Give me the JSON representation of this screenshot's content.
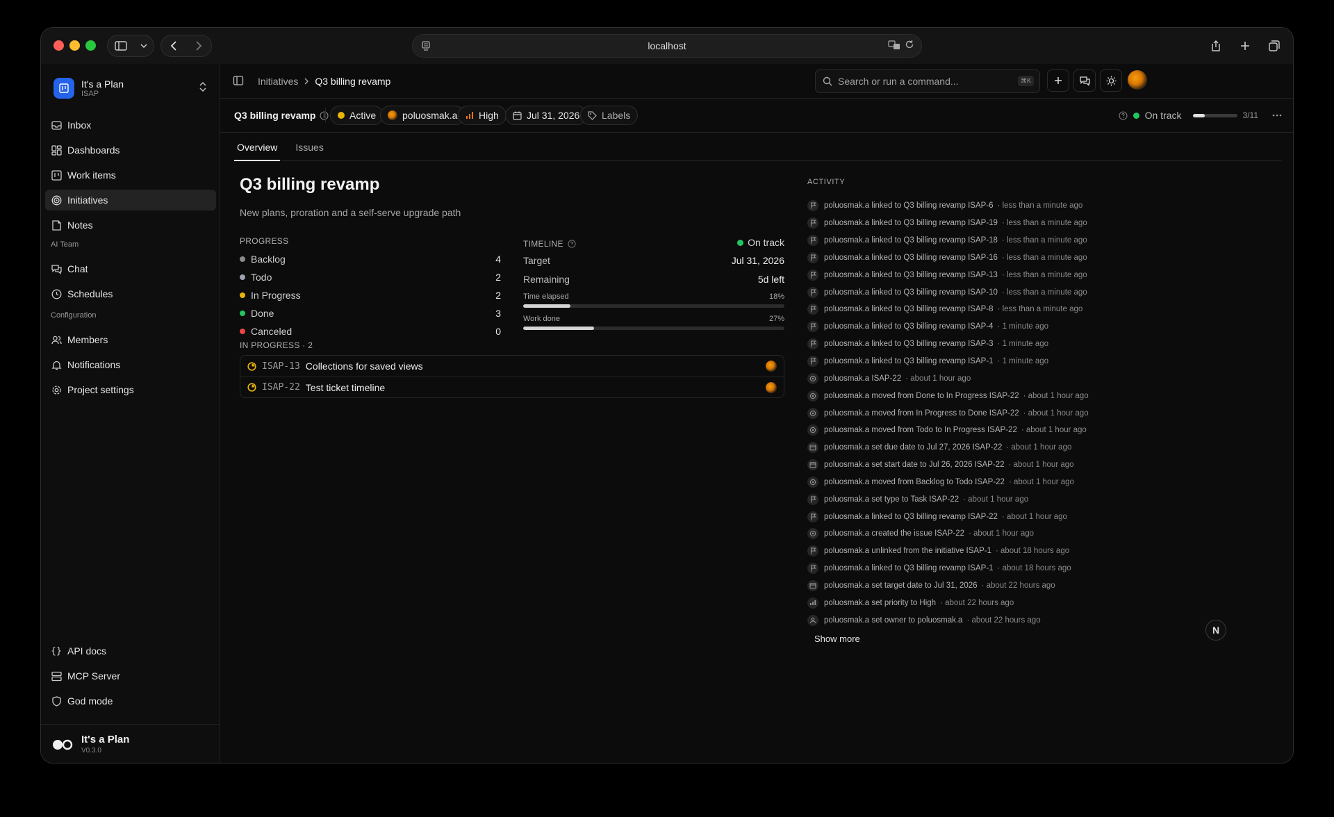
{
  "browser": {
    "url": "localhost"
  },
  "workspace": {
    "name": "It's a Plan",
    "key": "ISAP"
  },
  "sidebar": {
    "main_items": [
      {
        "label": "Inbox",
        "icon": "inbox-icon"
      },
      {
        "label": "Dashboards",
        "icon": "dashboard-icon"
      },
      {
        "label": "Work items",
        "icon": "kanban-icon"
      },
      {
        "label": "Initiatives",
        "icon": "target-icon",
        "active": true
      },
      {
        "label": "Notes",
        "icon": "note-icon"
      }
    ],
    "ai_team_title": "AI Team",
    "ai_team_items": [
      {
        "label": "Chat",
        "icon": "chat-icon"
      },
      {
        "label": "Schedules",
        "icon": "clock-icon"
      }
    ],
    "config_title": "Configuration",
    "config_items": [
      {
        "label": "Members",
        "icon": "users-icon"
      },
      {
        "label": "Notifications",
        "icon": "bell-icon"
      },
      {
        "label": "Project settings",
        "icon": "gear-icon"
      }
    ],
    "bottom_items": [
      {
        "label": "API docs",
        "icon": "braces-icon"
      },
      {
        "label": "MCP Server",
        "icon": "server-icon"
      },
      {
        "label": "God mode",
        "icon": "shield-icon"
      }
    ],
    "footer": {
      "name": "It's a Plan",
      "version": "V0.3.0"
    }
  },
  "topbar": {
    "breadcrumb": [
      "Initiatives",
      "Q3 billing revamp"
    ],
    "search_placeholder": "Search or run a command...",
    "search_shortcut": "⌘K"
  },
  "initiative": {
    "title": "Q3 billing revamp",
    "status": "Active",
    "owner": "poluosmak.a",
    "priority": "High",
    "target_date": "Jul 31, 2026",
    "labels": "Labels",
    "health": "On track",
    "issues_done": "3/11",
    "issues_progress": 0.27
  },
  "tabs": [
    "Overview",
    "Issues"
  ],
  "overview": {
    "title": "Q3 billing revamp",
    "description": "New plans, proration and a self-serve upgrade path",
    "progress_label": "PROGRESS",
    "progress": [
      {
        "label": "Backlog",
        "count": "4",
        "color": "#8a8a8a"
      },
      {
        "label": "Todo",
        "count": "2",
        "color": "#9ca3af"
      },
      {
        "label": "In Progress",
        "count": "2",
        "color": "#eab308"
      },
      {
        "label": "Done",
        "count": "3",
        "color": "#22c55e"
      },
      {
        "label": "Canceled",
        "count": "0",
        "color": "#ef4444"
      }
    ],
    "timeline_label": "TIMELINE",
    "timeline_status": "On track",
    "target_label": "Target",
    "target_value": "Jul 31, 2026",
    "remaining_label": "Remaining",
    "remaining_value": "5d left",
    "time_elapsed_label": "Time elapsed",
    "time_elapsed_pct": "18%",
    "time_elapsed_value": 0.18,
    "work_done_label": "Work done",
    "work_done_pct": "27%",
    "work_done_value": 0.27,
    "in_progress_label": "IN PROGRESS · 2",
    "in_progress_issues": [
      {
        "id": "ISAP-13",
        "title": "Collections for saved views"
      },
      {
        "id": "ISAP-22",
        "title": "Test ticket timeline"
      }
    ]
  },
  "activity": {
    "title": "ACTIVITY",
    "items": [
      {
        "text": "poluosmak.a linked to Q3 billing revamp ISAP-6",
        "time": "· less than a minute ago",
        "icon": "flag-icon"
      },
      {
        "text": "poluosmak.a linked to Q3 billing revamp ISAP-19",
        "time": "· less than a minute ago",
        "icon": "flag-icon"
      },
      {
        "text": "poluosmak.a linked to Q3 billing revamp ISAP-18",
        "time": "· less than a minute ago",
        "icon": "flag-icon"
      },
      {
        "text": "poluosmak.a linked to Q3 billing revamp ISAP-16",
        "time": "· less than a minute ago",
        "icon": "flag-icon"
      },
      {
        "text": "poluosmak.a linked to Q3 billing revamp ISAP-13",
        "time": "· less than a minute ago",
        "icon": "flag-icon"
      },
      {
        "text": "poluosmak.a linked to Q3 billing revamp ISAP-10",
        "time": "· less than a minute ago",
        "icon": "flag-icon"
      },
      {
        "text": "poluosmak.a linked to Q3 billing revamp ISAP-8",
        "time": "· less than a minute ago",
        "icon": "flag-icon"
      },
      {
        "text": "poluosmak.a linked to Q3 billing revamp ISAP-4",
        "time": "· 1 minute ago",
        "icon": "flag-icon"
      },
      {
        "text": "poluosmak.a linked to Q3 billing revamp ISAP-3",
        "time": "· 1 minute ago",
        "icon": "flag-icon"
      },
      {
        "text": "poluosmak.a linked to Q3 billing revamp ISAP-1",
        "time": "· 1 minute ago",
        "icon": "flag-icon"
      },
      {
        "text": "poluosmak.a ISAP-22",
        "time": "· about 1 hour ago",
        "icon": "circle-icon"
      },
      {
        "text": "poluosmak.a moved from Done to In Progress ISAP-22",
        "time": "· about 1 hour ago",
        "icon": "circle-icon"
      },
      {
        "text": "poluosmak.a moved from In Progress to Done ISAP-22",
        "time": "· about 1 hour ago",
        "icon": "circle-icon"
      },
      {
        "text": "poluosmak.a moved from Todo to In Progress ISAP-22",
        "time": "· about 1 hour ago",
        "icon": "circle-icon"
      },
      {
        "text": "poluosmak.a set due date to Jul 27, 2026 ISAP-22",
        "time": "· about 1 hour ago",
        "icon": "calendar-icon"
      },
      {
        "text": "poluosmak.a set start date to Jul 26, 2026 ISAP-22",
        "time": "· about 1 hour ago",
        "icon": "calendar-icon"
      },
      {
        "text": "poluosmak.a moved from Backlog to Todo ISAP-22",
        "time": "· about 1 hour ago",
        "icon": "circle-icon"
      },
      {
        "text": "poluosmak.a set type to Task ISAP-22",
        "time": "· about 1 hour ago",
        "icon": "flag-icon"
      },
      {
        "text": "poluosmak.a linked to Q3 billing revamp ISAP-22",
        "time": "· about 1 hour ago",
        "icon": "flag-icon"
      },
      {
        "text": "poluosmak.a created the issue ISAP-22",
        "time": "· about 1 hour ago",
        "icon": "circle-icon"
      },
      {
        "text": "poluosmak.a unlinked from the initiative ISAP-1",
        "time": "· about 18 hours ago",
        "icon": "flag-icon"
      },
      {
        "text": "poluosmak.a linked to Q3 billing revamp ISAP-1",
        "time": "· about 18 hours ago",
        "icon": "flag-icon"
      },
      {
        "text": "poluosmak.a set target date to Jul 31, 2026",
        "time": "· about 22 hours ago",
        "icon": "calendar-icon"
      },
      {
        "text": "poluosmak.a set priority to High",
        "time": "· about 22 hours ago",
        "icon": "priority-icon"
      },
      {
        "text": "poluosmak.a set owner to poluosmak.a",
        "time": "· about 22 hours ago",
        "icon": "user-icon"
      }
    ],
    "show_more": "Show more"
  },
  "fab_label": "N",
  "colors": {
    "accent_blue": "#2563eb",
    "status_active": "#eab308",
    "on_track": "#22c55e",
    "priority_high": "#f97316"
  }
}
